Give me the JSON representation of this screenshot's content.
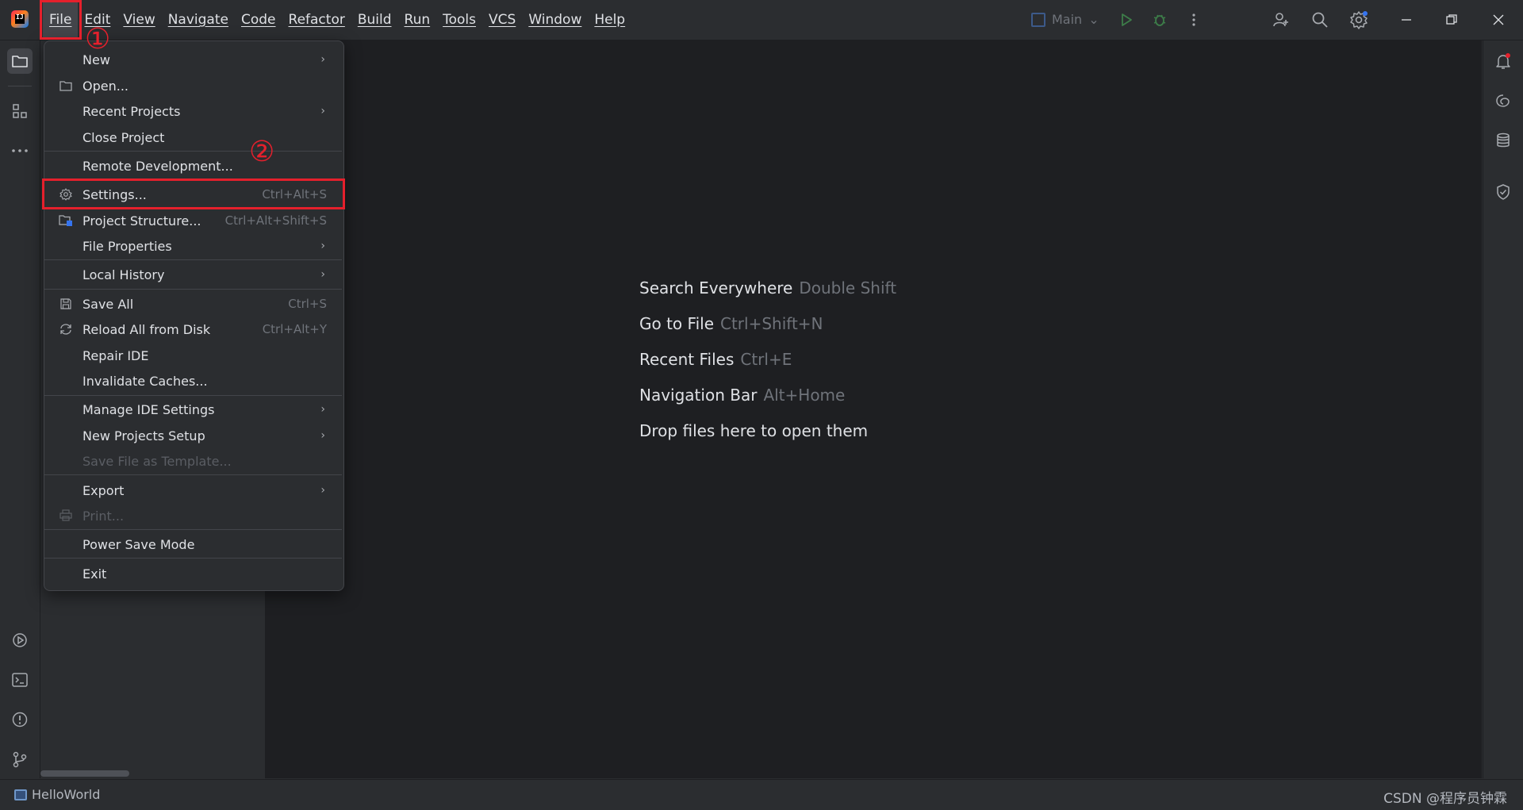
{
  "titlebar": {
    "menus": [
      "File",
      "Edit",
      "View",
      "Navigate",
      "Code",
      "Refactor",
      "Build",
      "Run",
      "Tools",
      "VCS",
      "Window",
      "Help"
    ],
    "run_config": "Main"
  },
  "file_menu": {
    "items": [
      {
        "label": "New",
        "shortcut": "",
        "submenu": true,
        "icon": "",
        "disabled": false
      },
      {
        "label": "Open...",
        "shortcut": "",
        "submenu": false,
        "icon": "folder-icon",
        "disabled": false
      },
      {
        "label": "Recent Projects",
        "shortcut": "",
        "submenu": true,
        "icon": "",
        "disabled": false
      },
      {
        "label": "Close Project",
        "shortcut": "",
        "submenu": false,
        "icon": "",
        "disabled": false
      },
      {
        "label": "Remote Development...",
        "shortcut": "",
        "submenu": false,
        "icon": "",
        "disabled": false
      },
      {
        "label": "Settings...",
        "shortcut": "Ctrl+Alt+S",
        "submenu": false,
        "icon": "gear-icon",
        "disabled": false
      },
      {
        "label": "Project Structure...",
        "shortcut": "Ctrl+Alt+Shift+S",
        "submenu": false,
        "icon": "project-structure-icon",
        "disabled": false
      },
      {
        "label": "File Properties",
        "shortcut": "",
        "submenu": true,
        "icon": "",
        "disabled": false
      },
      {
        "label": "Local History",
        "shortcut": "",
        "submenu": true,
        "icon": "",
        "disabled": false
      },
      {
        "label": "Save All",
        "shortcut": "Ctrl+S",
        "submenu": false,
        "icon": "save-icon",
        "disabled": false
      },
      {
        "label": "Reload All from Disk",
        "shortcut": "Ctrl+Alt+Y",
        "submenu": false,
        "icon": "reload-icon",
        "disabled": false
      },
      {
        "label": "Repair IDE",
        "shortcut": "",
        "submenu": false,
        "icon": "",
        "disabled": false
      },
      {
        "label": "Invalidate Caches...",
        "shortcut": "",
        "submenu": false,
        "icon": "",
        "disabled": false
      },
      {
        "label": "Manage IDE Settings",
        "shortcut": "",
        "submenu": true,
        "icon": "",
        "disabled": false
      },
      {
        "label": "New Projects Setup",
        "shortcut": "",
        "submenu": true,
        "icon": "",
        "disabled": false
      },
      {
        "label": "Save File as Template...",
        "shortcut": "",
        "submenu": false,
        "icon": "",
        "disabled": true
      },
      {
        "label": "Export",
        "shortcut": "",
        "submenu": true,
        "icon": "",
        "disabled": false
      },
      {
        "label": "Print...",
        "shortcut": "",
        "submenu": false,
        "icon": "print-icon",
        "disabled": true
      },
      {
        "label": "Power Save Mode",
        "shortcut": "",
        "submenu": false,
        "icon": "",
        "disabled": false
      },
      {
        "label": "Exit",
        "shortcut": "",
        "submenu": false,
        "icon": "",
        "disabled": false
      }
    ]
  },
  "editor_hints": [
    {
      "action": "Search Everywhere",
      "key": "Double Shift"
    },
    {
      "action": "Go to File",
      "key": "Ctrl+Shift+N"
    },
    {
      "action": "Recent Files",
      "key": "Ctrl+E"
    },
    {
      "action": "Navigation Bar",
      "key": "Alt+Home"
    },
    {
      "action": "Drop files here to open them",
      "key": ""
    }
  ],
  "statusbar": {
    "project": "HelloWorld",
    "watermark": "CSDN @程序员钟霖"
  },
  "annotations": {
    "step1": "①",
    "step2": "②"
  },
  "colors": {
    "accent_red": "#e5202c",
    "background": "#2b2d30",
    "editor_bg": "#1e1f22"
  }
}
